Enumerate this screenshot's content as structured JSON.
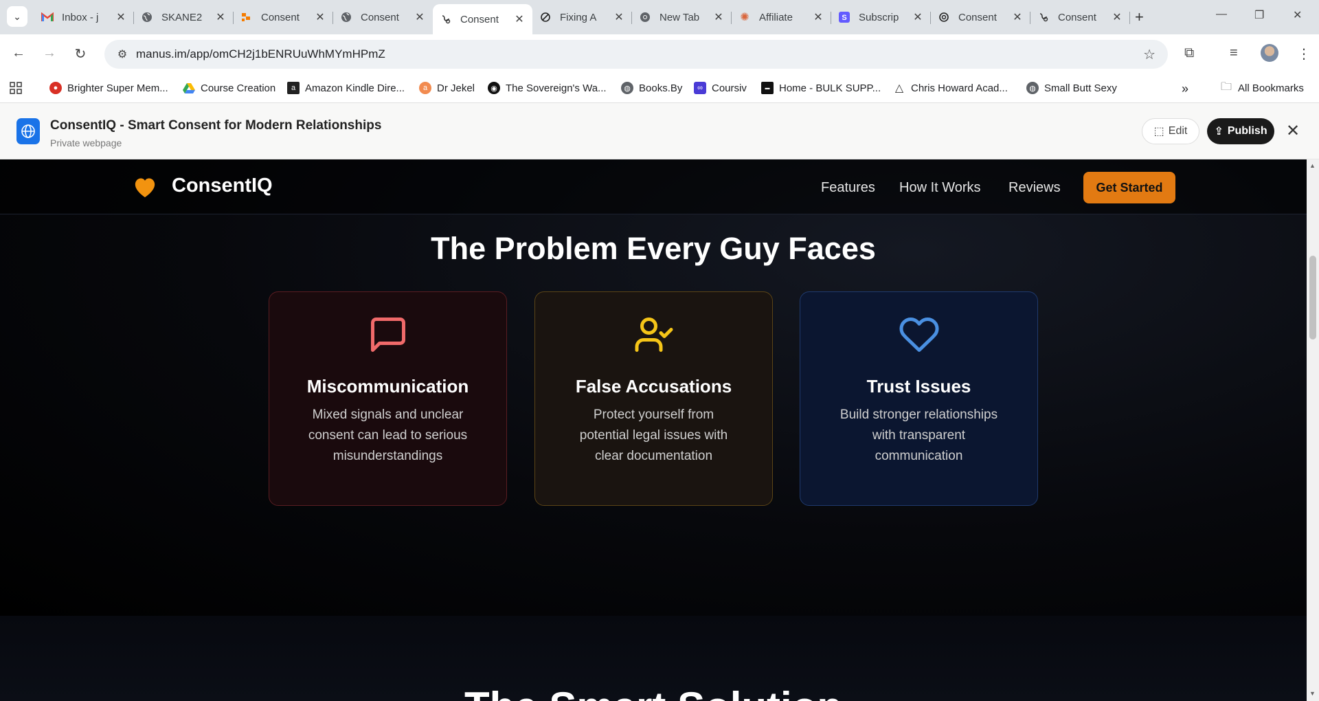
{
  "browser": {
    "tabs": [
      {
        "title": "Inbox - j",
        "icon": "gmail-icon"
      },
      {
        "title": "SKANE2",
        "icon": "globe-icon"
      },
      {
        "title": "Consent",
        "icon": "orange-app-icon"
      },
      {
        "title": "Consent",
        "icon": "globe-icon"
      },
      {
        "title": "Consent",
        "icon": "manus-icon"
      },
      {
        "title": "Fixing A",
        "icon": "perplexity-icon"
      },
      {
        "title": "New Tab",
        "icon": "chrome-icon"
      },
      {
        "title": "Affiliate",
        "icon": "claude-icon"
      },
      {
        "title": "Subscrip",
        "icon": "stripe-icon"
      },
      {
        "title": "Consent",
        "icon": "openai-icon"
      },
      {
        "title": "Consent",
        "icon": "manus-icon"
      }
    ],
    "active_tab": 4,
    "url": "manus.im/app/omCH2j1bENRUuWhMYmHPmZ",
    "bookmarks": [
      {
        "label": "Brighter Super Mem...",
        "color": "#d93025"
      },
      {
        "label": "Course Creation",
        "color": "#34a853"
      },
      {
        "label": "Amazon Kindle Dire...",
        "color": "#222222"
      },
      {
        "label": "Dr Jekel",
        "color": "#f28b50"
      },
      {
        "label": "The Sovereign's Wa...",
        "color": "#111111"
      },
      {
        "label": "Books.By",
        "color": "#5f6368"
      },
      {
        "label": "Coursiv",
        "color": "#4a3bd6"
      },
      {
        "label": "Home - BULK SUPP...",
        "color": "#111111"
      },
      {
        "label": "Chris Howard Acad...",
        "color": "#333333"
      },
      {
        "label": "Small Butt Sexy",
        "color": "#5f6368"
      }
    ],
    "all_bookmarks": "All Bookmarks"
  },
  "manus": {
    "title": "ConsentIQ - Smart Consent for Modern Relationships",
    "subtitle": "Private webpage",
    "edit_label": "Edit",
    "publish_label": "Publish"
  },
  "site": {
    "brand": "ConsentIQ",
    "nav": [
      "Features",
      "How It Works",
      "Reviews"
    ],
    "cta": "Get Started",
    "section_title": "The Problem Every Guy Faces",
    "cards": [
      {
        "title": "Miscommunication",
        "text": "Mixed signals and unclear consent can lead to serious misunderstandings",
        "icon": "message-square-icon",
        "color": "#f06a6a"
      },
      {
        "title": "False Accusations",
        "text": "Protect yourself from potential legal issues with clear documentation",
        "icon": "user-check-icon",
        "color": "#f5c518"
      },
      {
        "title": "Trust Issues",
        "text": "Build stronger relationships with transparent communication",
        "icon": "heart-icon",
        "color": "#4a90e2"
      }
    ],
    "next_section_title": "The Smart Solution",
    "accent": "#e27a12"
  }
}
